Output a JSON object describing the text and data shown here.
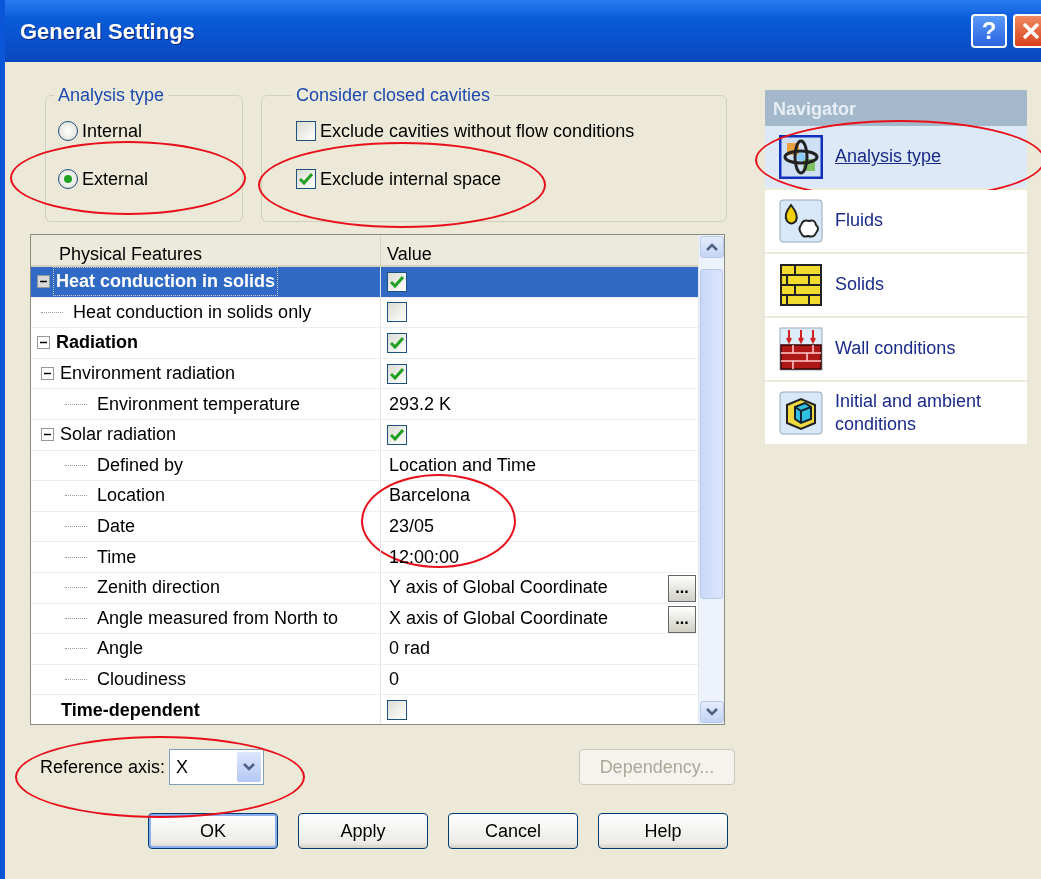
{
  "window": {
    "title": "General Settings",
    "help_button": "?"
  },
  "analysis_type": {
    "legend": "Analysis type",
    "options": [
      {
        "label": "Internal",
        "selected": false,
        "circled": false
      },
      {
        "label": "External",
        "selected": true,
        "circled": true
      }
    ]
  },
  "closed_cavities": {
    "legend": "Consider closed cavities",
    "options": [
      {
        "label": "Exclude cavities without flow conditions",
        "checked": false,
        "circled": false
      },
      {
        "label": "Exclude internal space",
        "checked": true,
        "circled": true
      }
    ]
  },
  "features_table": {
    "columns": [
      "Physical Features",
      "Value"
    ],
    "rows": [
      {
        "label": "Heat conduction in solids",
        "kind": "checkbox",
        "checked": true,
        "selected": true,
        "circled": false,
        "expanded": true,
        "children": [
          {
            "label": "Heat conduction in solids only",
            "kind": "checkbox",
            "checked": false,
            "selected": false,
            "circled": false
          }
        ]
      },
      {
        "label": "Radiation",
        "kind": "checkbox",
        "checked": true,
        "selected": false,
        "circled": false,
        "expanded": true,
        "children": [
          {
            "label": "Environment radiation",
            "kind": "checkbox",
            "checked": true,
            "selected": false,
            "circled": false,
            "expanded": true,
            "children": [
              {
                "label": "Environment temperature",
                "kind": "text",
                "value": "293.2 K",
                "selected": false,
                "circled": false
              }
            ]
          },
          {
            "label": "Solar radiation",
            "kind": "checkbox",
            "checked": true,
            "selected": false,
            "circled": false,
            "expanded": true,
            "children": [
              {
                "label": "Defined by",
                "kind": "text",
                "value": "Location and Time",
                "selected": false,
                "circled": false
              },
              {
                "label": "Location",
                "kind": "text",
                "value": "Barcelona",
                "selected": false,
                "circled": false
              },
              {
                "label": "Date",
                "kind": "text",
                "value": "23/05",
                "selected": false,
                "circled": true
              },
              {
                "label": "Time",
                "kind": "text",
                "value": "12:00:00",
                "selected": false,
                "circled": false
              },
              {
                "label": "Zenith direction",
                "kind": "text",
                "value": "Y  axis of Global Coordinate",
                "browse": "...",
                "selected": false,
                "circled": false
              },
              {
                "label": "Angle measured from North to",
                "kind": "text",
                "value": "X  axis of Global Coordinate",
                "browse": "...",
                "selected": false,
                "circled": false
              },
              {
                "label": "Angle",
                "kind": "text",
                "value": "0 rad",
                "selected": false,
                "circled": false
              },
              {
                "label": "Cloudiness",
                "kind": "text",
                "value": "0",
                "selected": false,
                "circled": false
              }
            ]
          }
        ]
      },
      {
        "label": "Time-dependent",
        "kind": "checkbox",
        "checked": false,
        "selected": false,
        "circled": false
      }
    ]
  },
  "reference_axis": {
    "label": "Reference axis:",
    "value": "X",
    "circled": true
  },
  "dependency_button": {
    "label": "Dependency...",
    "disabled": true
  },
  "buttons": [
    {
      "label": "OK",
      "default": true
    },
    {
      "label": "Apply",
      "default": false
    },
    {
      "label": "Cancel",
      "default": false
    },
    {
      "label": "Help",
      "default": false
    }
  ],
  "navigator": {
    "title": "Navigator",
    "items": [
      {
        "label": "Analysis type",
        "selected": true,
        "circled": true
      },
      {
        "label": "Fluids",
        "selected": false,
        "circled": false
      },
      {
        "label": "Solids",
        "selected": false,
        "circled": false
      },
      {
        "label": "Wall conditions",
        "selected": false,
        "circled": false
      },
      {
        "label": "Initial and ambient conditions",
        "selected": false,
        "circled": false
      }
    ]
  }
}
